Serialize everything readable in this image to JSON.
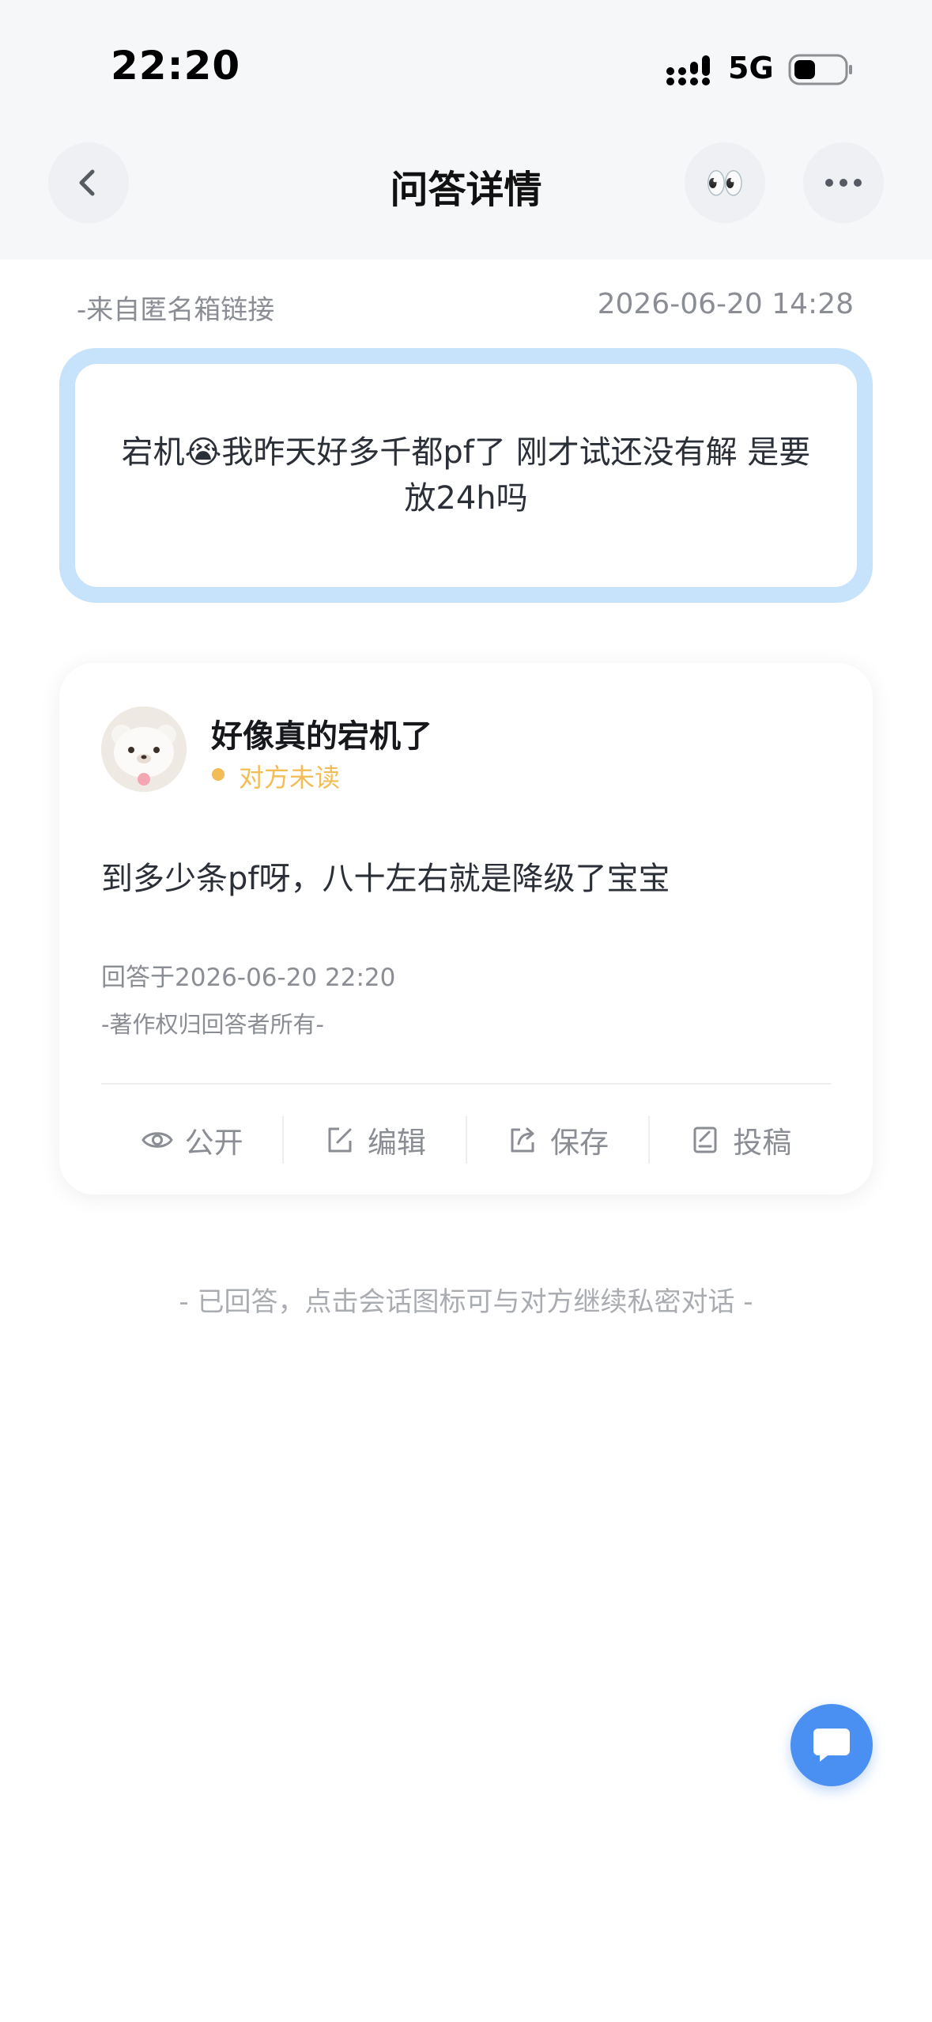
{
  "status_bar": {
    "time": "22:20",
    "network": "5G",
    "icons": [
      "signal-icon",
      "battery-icon"
    ]
  },
  "nav": {
    "title": "问答详情",
    "back_icon": "chevron-left-icon",
    "eyes_emoji": "👀",
    "more_icon": "more-horizontal-icon"
  },
  "meta": {
    "source": "-来自匿名箱链接",
    "datetime": "2026-06-20 14:28"
  },
  "question": {
    "text": "宕机😭我昨天好多千都pf了 刚才试还没有解 是要放24h吗"
  },
  "answer": {
    "user_name": "好像真的宕机了",
    "status": "对方未读",
    "text": "到多少条pf呀，八十左右就是降级了宝宝",
    "answered_at": "回答于2026-06-20 22:20",
    "copyright": "-著作权归回答者所有-",
    "actions": [
      {
        "label": "公开",
        "icon": "eye-icon"
      },
      {
        "label": "编辑",
        "icon": "edit-icon"
      },
      {
        "label": "保存",
        "icon": "share-icon"
      },
      {
        "label": "投稿",
        "icon": "document-icon"
      }
    ]
  },
  "footer_note": "- 已回答，点击会话图标可与对方继续私密对话 -",
  "colors": {
    "accent": "#4a8ff2",
    "question_frame": "#c7e2fb",
    "status_unread": "#f2bd57"
  }
}
